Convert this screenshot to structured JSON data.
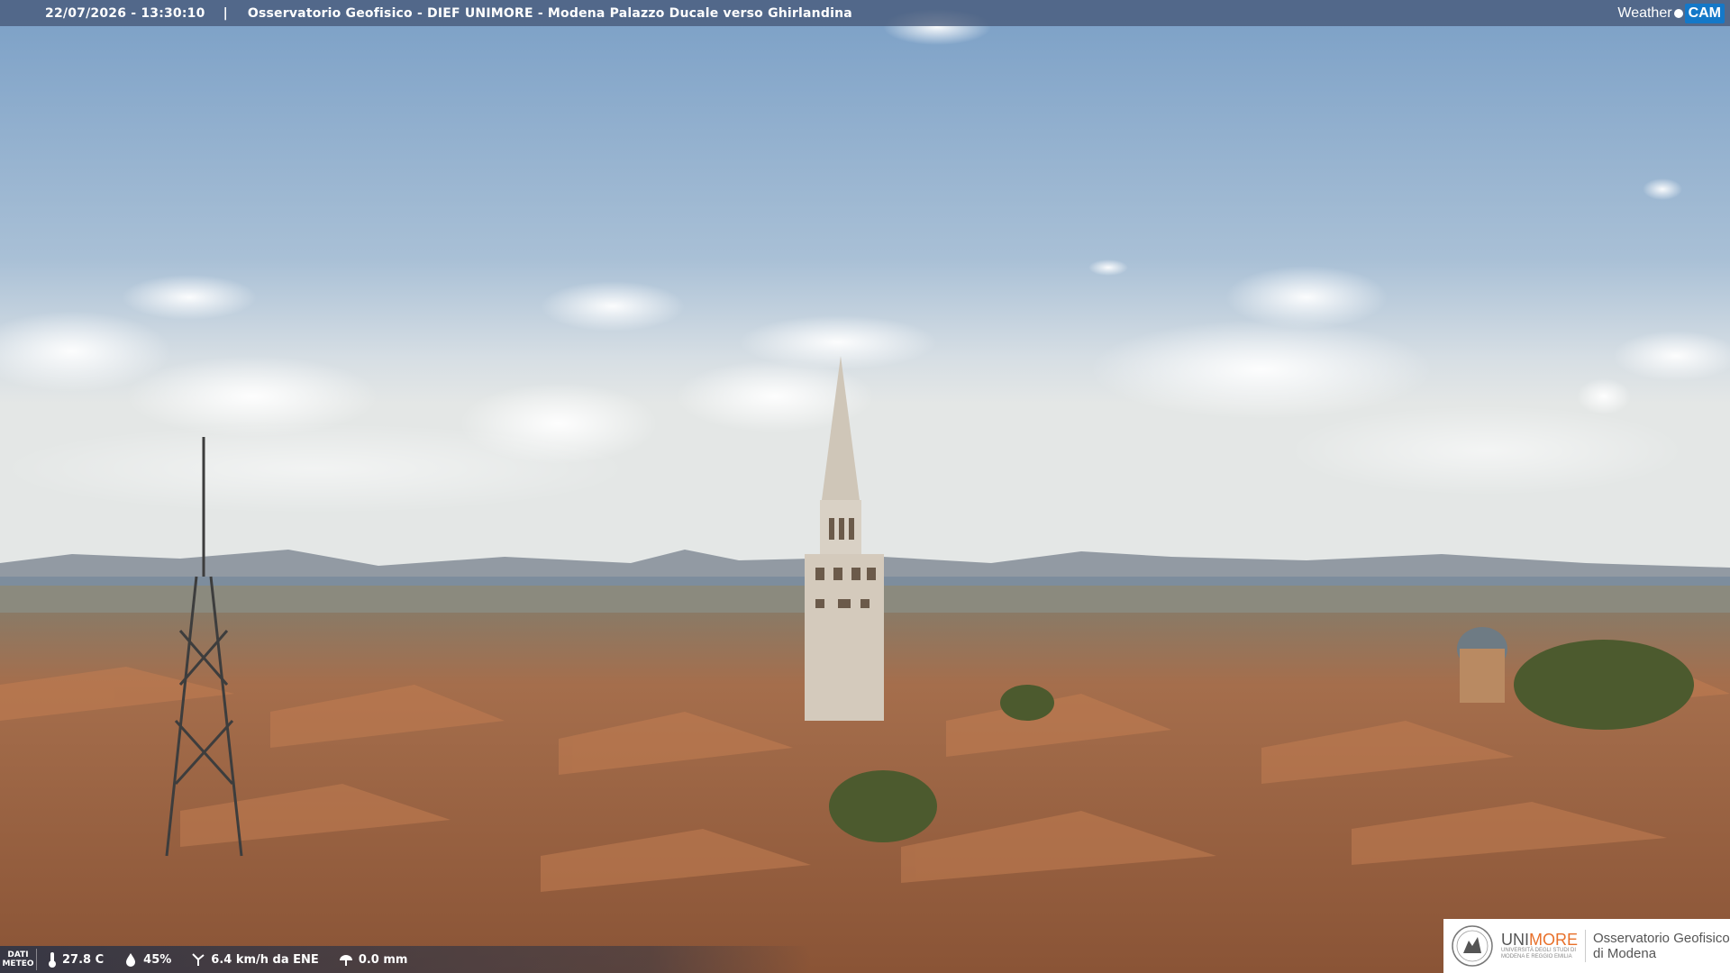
{
  "header": {
    "timestamp": "22/07/2026 - 13:30:10",
    "separator": "|",
    "title": "Osservatorio Geofisico - DIEF UNIMORE - Modena Palazzo Ducale verso Ghirlandina"
  },
  "brand": {
    "weather": "Weather",
    "cam": "CAM"
  },
  "meteo": {
    "label_line1": "DATI",
    "label_line2": "METEO",
    "temperature": "27.8 C",
    "humidity": "45%",
    "wind": "6.4 km/h da ENE",
    "rain": "0.0 mm"
  },
  "logo": {
    "uni_prefix": "UNI",
    "uni_suffix": "MORE",
    "uni_sub1": "UNIVERSITÀ DEGLI STUDI DI",
    "uni_sub2": "MODENA E REGGIO EMILIA",
    "obs_line1": "Osservatorio Geofisico",
    "obs_line2": "di Modena"
  },
  "colors": {
    "sky_top": "#7fa3c8",
    "sky_horizon": "#dfe6ea",
    "roof": "#b8764c",
    "tower": "#d8cfc2",
    "accent_orange": "#e8702a",
    "cam_blue": "#1478c8"
  },
  "icons": [
    "thermometer-icon",
    "humidity-icon",
    "wind-icon",
    "rain-icon",
    "weathercam-logo",
    "unimore-seal-icon"
  ]
}
